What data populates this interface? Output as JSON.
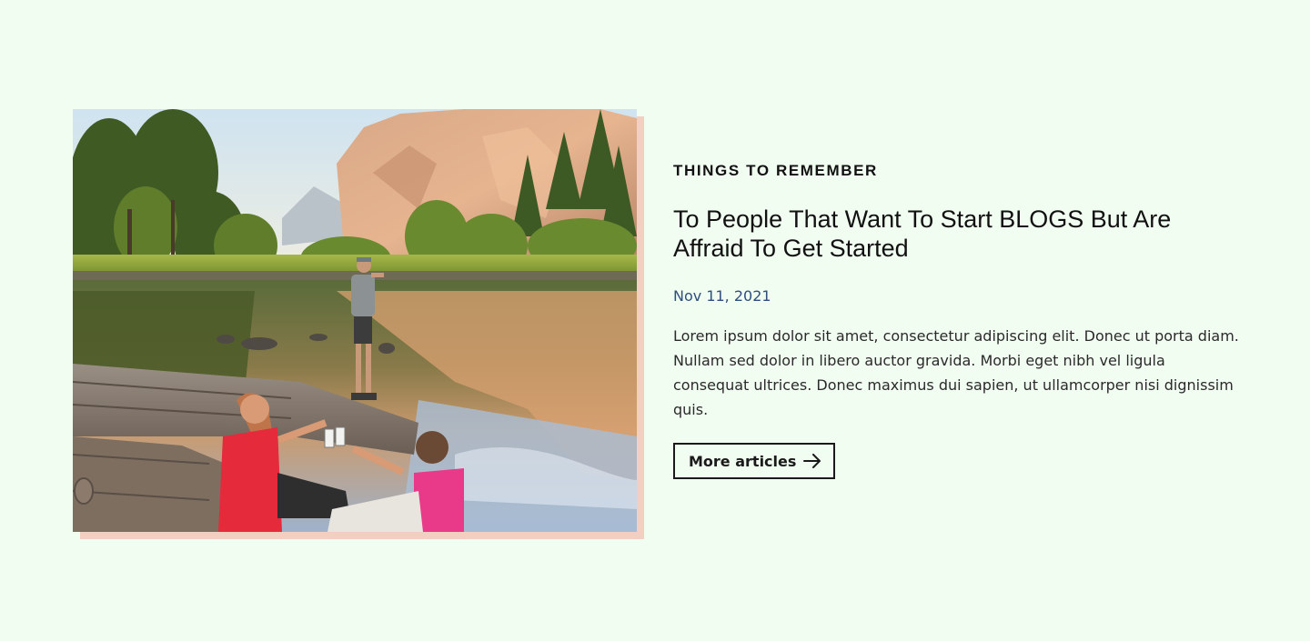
{
  "article": {
    "eyebrow": "THINGS TO REMEMBER",
    "title": "To People That Want To Start BLOGS But Are Affraid To Get Started",
    "date": "Nov 11, 2021",
    "excerpt": "Lorem ipsum dolor sit amet, consectetur adipiscing elit. Donec ut porta diam. Nullam sed dolor in libero auctor gravida. Morbi eget nibh vel ligula consequat ultrices. Donec maximus dui sapien, ut ullamcorper nisi dignissim quis.",
    "button_label": "More articles",
    "button_icon": "arrow-right-icon",
    "image_subject": "hikers-by-mountain-lake-photo"
  },
  "colors": {
    "page_background": "#f2fdf2",
    "photo_shadow": "#f3cfc1",
    "date_text": "#2d4f7e",
    "text": "#111111"
  }
}
